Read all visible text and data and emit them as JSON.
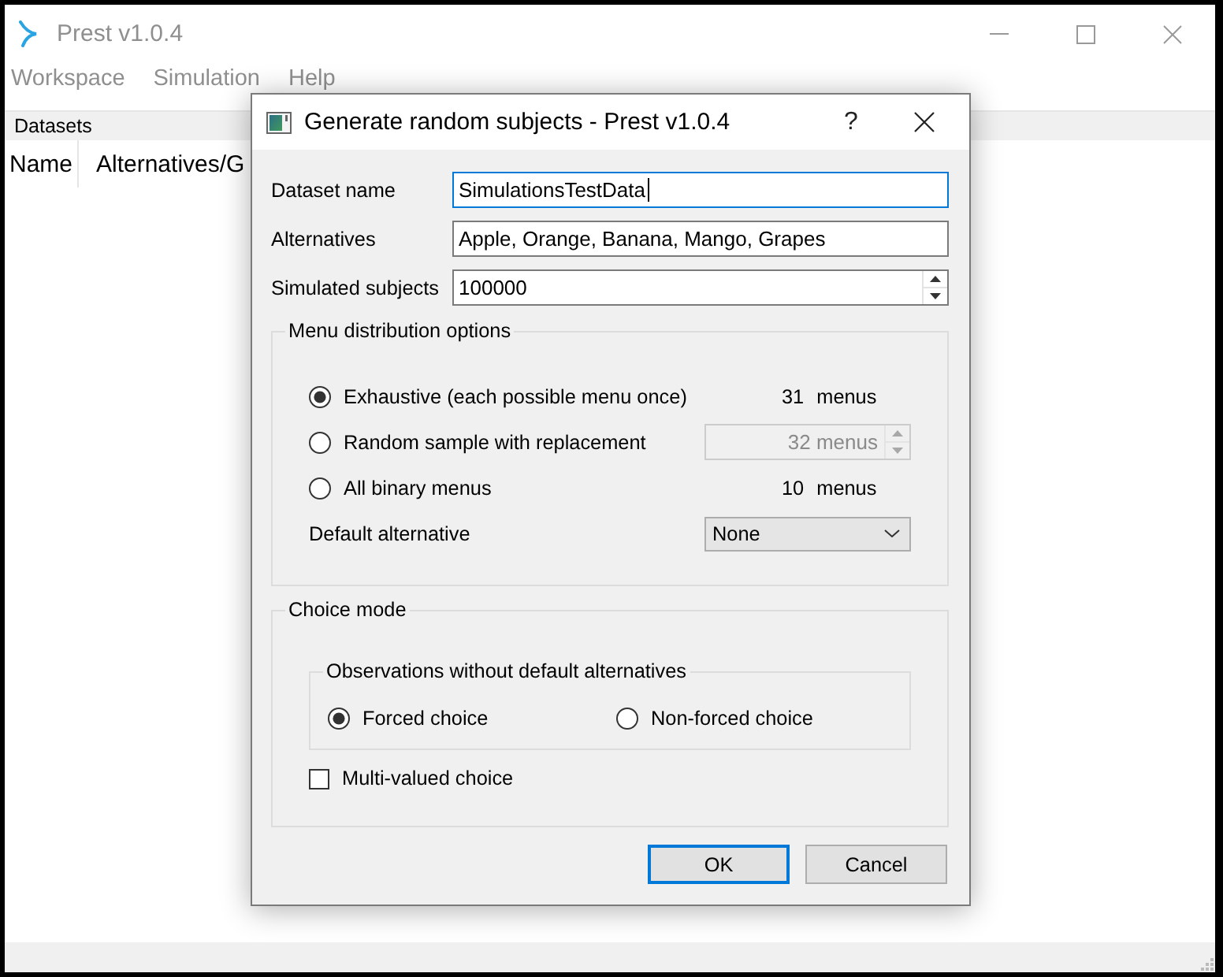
{
  "window": {
    "title": "Prest v1.0.4",
    "active": false
  },
  "menu_bar": [
    {
      "label": "Workspace"
    },
    {
      "label": "Simulation"
    },
    {
      "label": "Help"
    }
  ],
  "datasets_panel": {
    "title": "Datasets",
    "columns": [
      "Name",
      "Alternatives/G"
    ]
  },
  "dialog": {
    "title": "Generate random subjects - Prest v1.0.4",
    "help_button": "?",
    "fields": [
      {
        "label": "Dataset name",
        "kind": "text",
        "value": "SimulationsTestData",
        "focused": true
      },
      {
        "label": "Alternatives",
        "kind": "text",
        "value": "Apple, Orange, Banana, Mango, Grapes",
        "focused": false
      },
      {
        "label": "Simulated subjects",
        "kind": "spin",
        "value": "100000",
        "focused": false
      }
    ],
    "menu_distribution": {
      "title": "Menu distribution options",
      "options": [
        {
          "label": "Exhaustive (each possible menu once)",
          "selected": true,
          "kind": "count",
          "count": "31",
          "unit": "menus",
          "disabled": false
        },
        {
          "label": "Random sample with replacement",
          "selected": false,
          "kind": "spin",
          "value": "32 menus",
          "disabled": true
        },
        {
          "label": "All binary menus",
          "selected": false,
          "kind": "count",
          "count": "10",
          "unit": "menus",
          "disabled": false
        }
      ],
      "default_alternative": {
        "label": "Default alternative",
        "value": "None"
      }
    },
    "choice_mode": {
      "title": "Choice mode",
      "observations": {
        "title": "Observations without default alternatives",
        "options": [
          {
            "label": "Forced choice",
            "selected": true
          },
          {
            "label": "Non-forced choice",
            "selected": false
          }
        ]
      },
      "multi_valued": {
        "label": "Multi-valued choice",
        "checked": false
      }
    },
    "buttons": [
      {
        "label": "OK",
        "default": true
      },
      {
        "label": "Cancel",
        "default": false
      }
    ]
  }
}
